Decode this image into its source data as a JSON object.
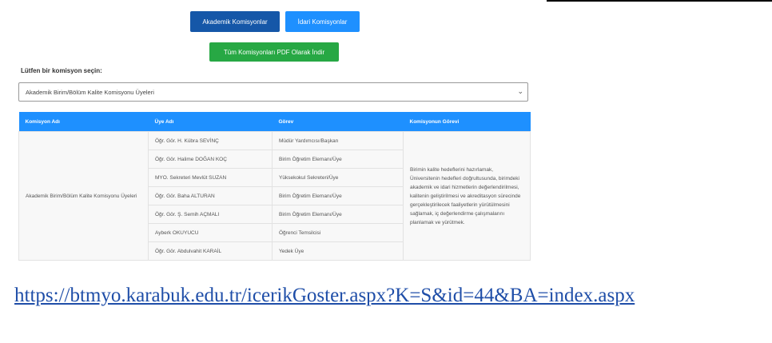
{
  "buttons": {
    "akademik": "Akademik Komisyonlar",
    "idari": "İdari Komisyonlar",
    "pdf": "Tüm Komisyonları PDF Olarak İndir"
  },
  "select": {
    "label": "Lütfen bir komisyon seçin:",
    "value": "Akademik Birim/Bölüm Kalite Komisyonu Üyeleri"
  },
  "table": {
    "headers": [
      "Komisyon Adı",
      "Üye Adı",
      "Görev",
      "Komisyonun Görevi"
    ],
    "komisyon_adi": "Akademik Birim/Bölüm Kalite Komisyonu Üyeleri",
    "gorev_tanimi": "Birimin kalite hedeflerini hazırlamak, Üniversitenin hedefleri doğrultusunda, birimdeki akademik ve idari hizmetlerin değerlendirilmesi, kalitenin geliştirilmesi ve akreditasyon sürecinde gerçekleştirilecek faaliyetlerin yürütülmesini sağlamak, iç değerlendirme çalışmalarını planlamak ve yürütmek.",
    "rows": [
      {
        "uye": "Öğr. Gör. H. Kübra SEVİNÇ",
        "gorev": "Müdür Yardımcısı/Başkan"
      },
      {
        "uye": "Öğr. Gör. Halime DOĞAN KOÇ",
        "gorev": "Birim Öğretim Elemanı/Üye"
      },
      {
        "uye": "MYO. Sekreteri Mevlüt SUZAN",
        "gorev": "Yüksekokul Sekreteri/Üye"
      },
      {
        "uye": "Öğr. Gör. Baha ALTURAN",
        "gorev": "Birim Öğretim Elemanı/Üye"
      },
      {
        "uye": "Öğr. Gör. Ş. Semih AÇMALI",
        "gorev": "Birim Öğretim Elemanı/Üye"
      },
      {
        "uye": "Ayberk OKUYUCU",
        "gorev": "Öğrenci Temsilcisi"
      },
      {
        "uye": "Öğr. Gör. Abdulvahit KARAİL",
        "gorev": "Yedek Üye"
      }
    ]
  },
  "url": "https://btmyo.karabuk.edu.tr/icerikGoster.aspx?K=S&id=44&BA=index.aspx",
  "colors": {
    "primary_dark": "#1557a8",
    "primary": "#1e90ff",
    "success": "#27a844",
    "link": "#1f4ea8"
  }
}
